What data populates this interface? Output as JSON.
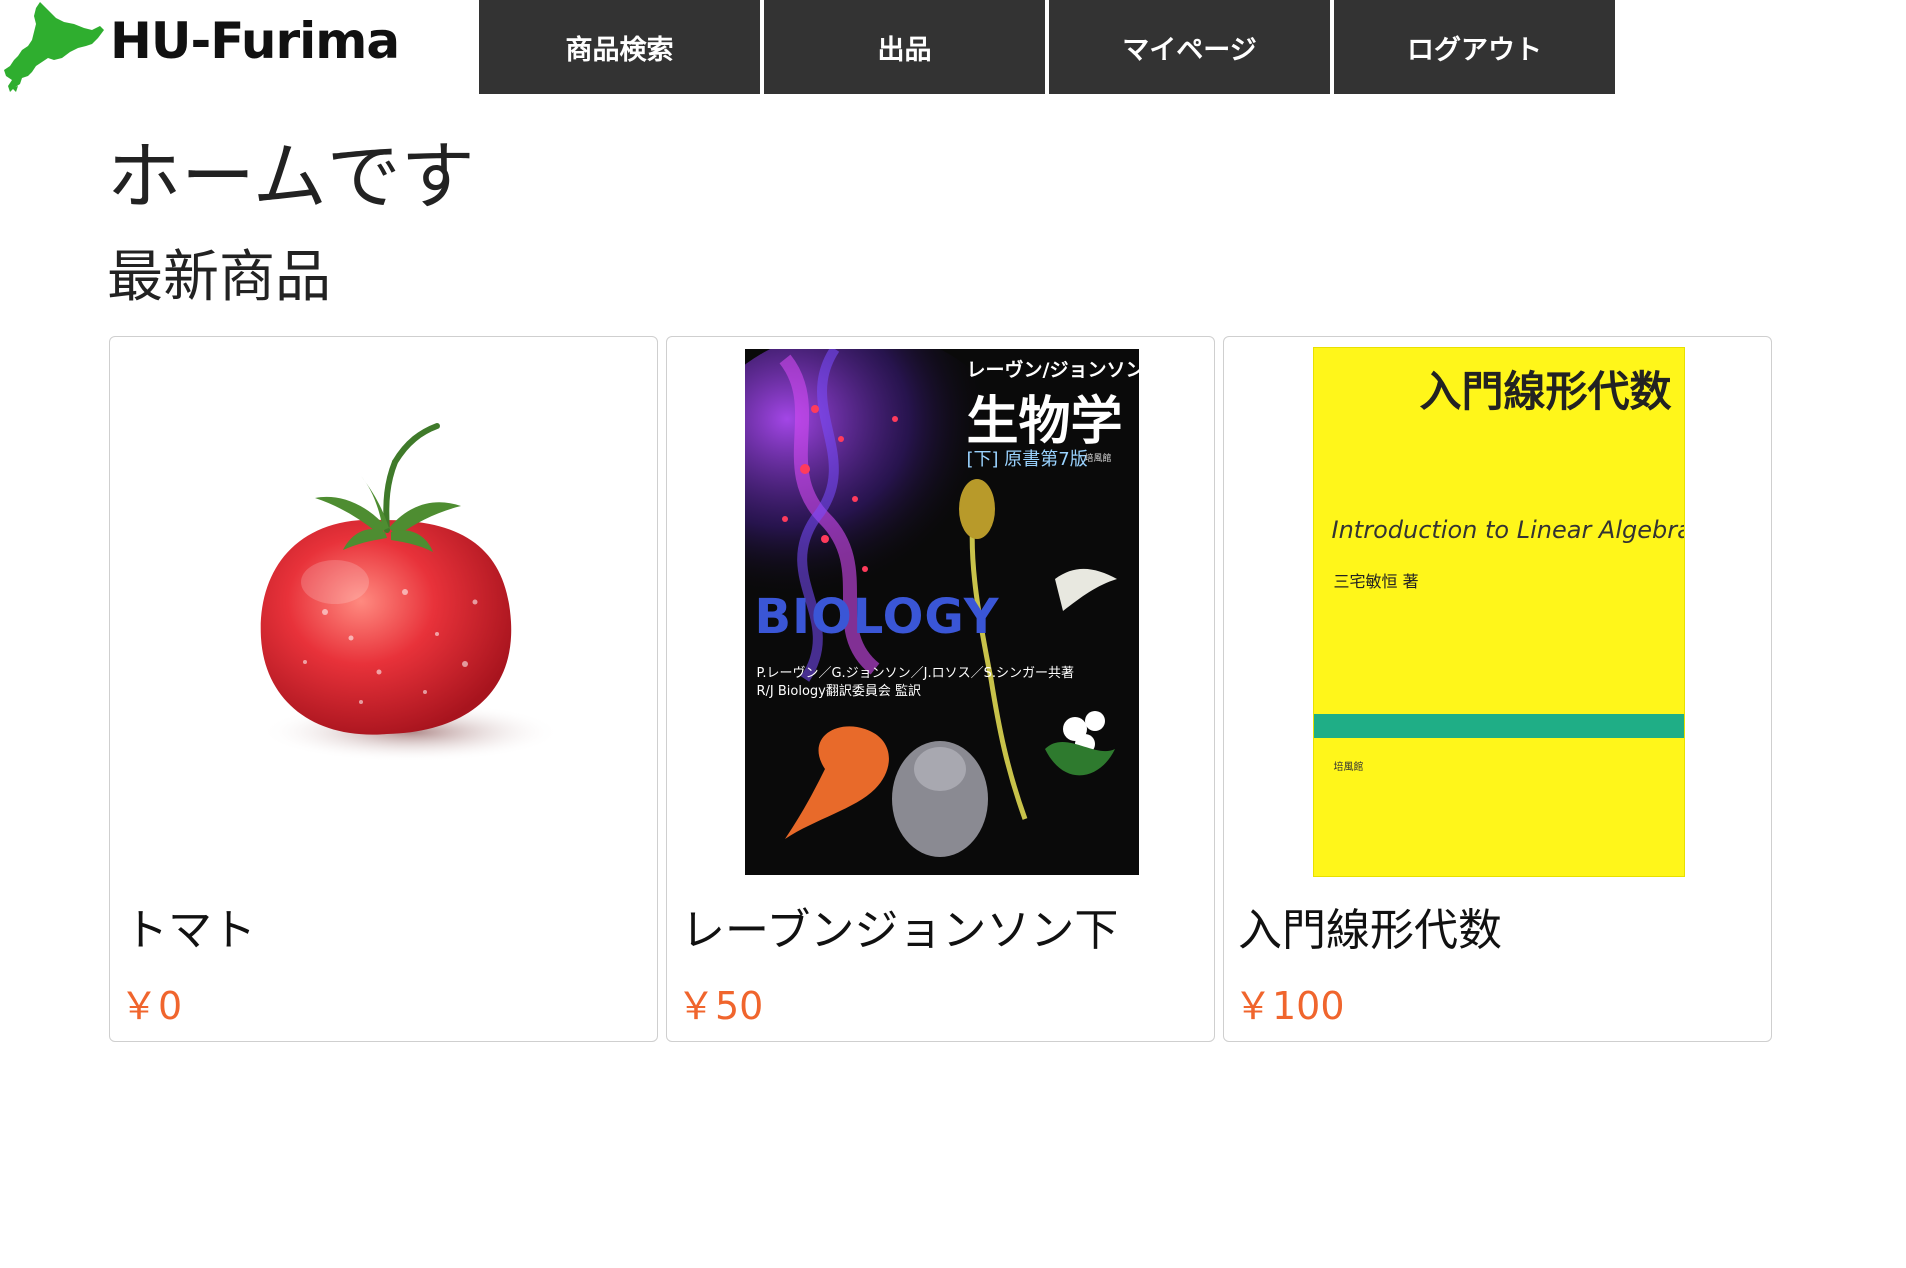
{
  "header": {
    "logo_text": "HU-Furima",
    "logo_icon": "hokkaido-map-icon",
    "nav": [
      {
        "label": "商品検索"
      },
      {
        "label": "出品"
      },
      {
        "label": "マイページ"
      },
      {
        "label": "ログアウト"
      }
    ]
  },
  "main": {
    "title": "ホームです",
    "section_title": "最新商品"
  },
  "products": [
    {
      "name": "トマト",
      "price": "￥0",
      "image": "tomato-image"
    },
    {
      "name": "レーブンジョンソン下",
      "price": "￥50",
      "image": "biology-book-cover",
      "cover": {
        "author": "レーヴン/ジョンソン",
        "title": "生物学",
        "volume": "[下]  原書第7版",
        "publisher": "培風館",
        "logo": "BIOLOGY",
        "credits_1": "P.レーヴン／G.ジョンソン／J.ロソス／S.シンガー共著",
        "credits_2": "R/J Biology翻訳委員会 監訳"
      }
    },
    {
      "name": "入門線形代数",
      "price": "￥100",
      "image": "linear-algebra-book-cover",
      "cover": {
        "title": "入門線形代数",
        "subtitle": "Introduction to Linear Algebra",
        "author": "三宅敏恒 著",
        "publisher": "培風館"
      }
    }
  ],
  "colors": {
    "nav_bg": "#333333",
    "price": "#f0652d",
    "logo_green": "#2fae2f",
    "book_yellow": "#fff61a",
    "book_band": "#1fae86"
  }
}
